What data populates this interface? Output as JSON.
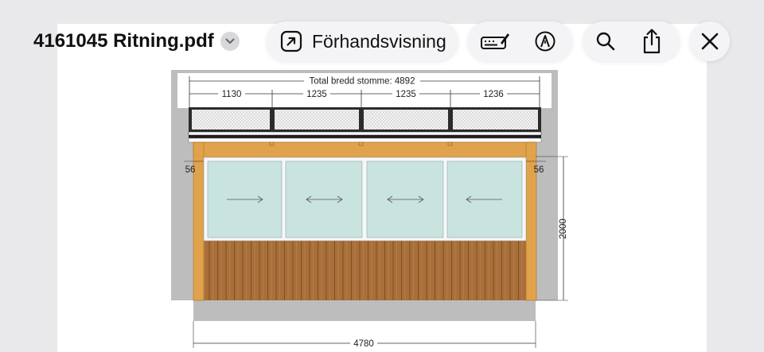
{
  "toolbar": {
    "document_title": "4161045 Ritning.pdf",
    "preview_label": "Förhandsvisning"
  },
  "icons": {
    "title_menu": "chevron-down-icon",
    "preview": "open-arrow-icon",
    "markup": "markup-pen-icon",
    "annotate": "pen-tip-icon",
    "search": "search-icon",
    "share": "share-icon",
    "close": "close-icon"
  },
  "drawing": {
    "total_width_label": "Total bredd stomme: 4892",
    "segment_widths": [
      "1130",
      "1235",
      "1235",
      "1236"
    ],
    "left_post": "56",
    "right_post": "56",
    "height": "2000",
    "overall_width": "4780"
  },
  "colors": {
    "wood": "#e0a24a",
    "wood_dark": "#a96f3a",
    "glass": "#c9e3df",
    "gray_bg": "#bdbdbd"
  }
}
